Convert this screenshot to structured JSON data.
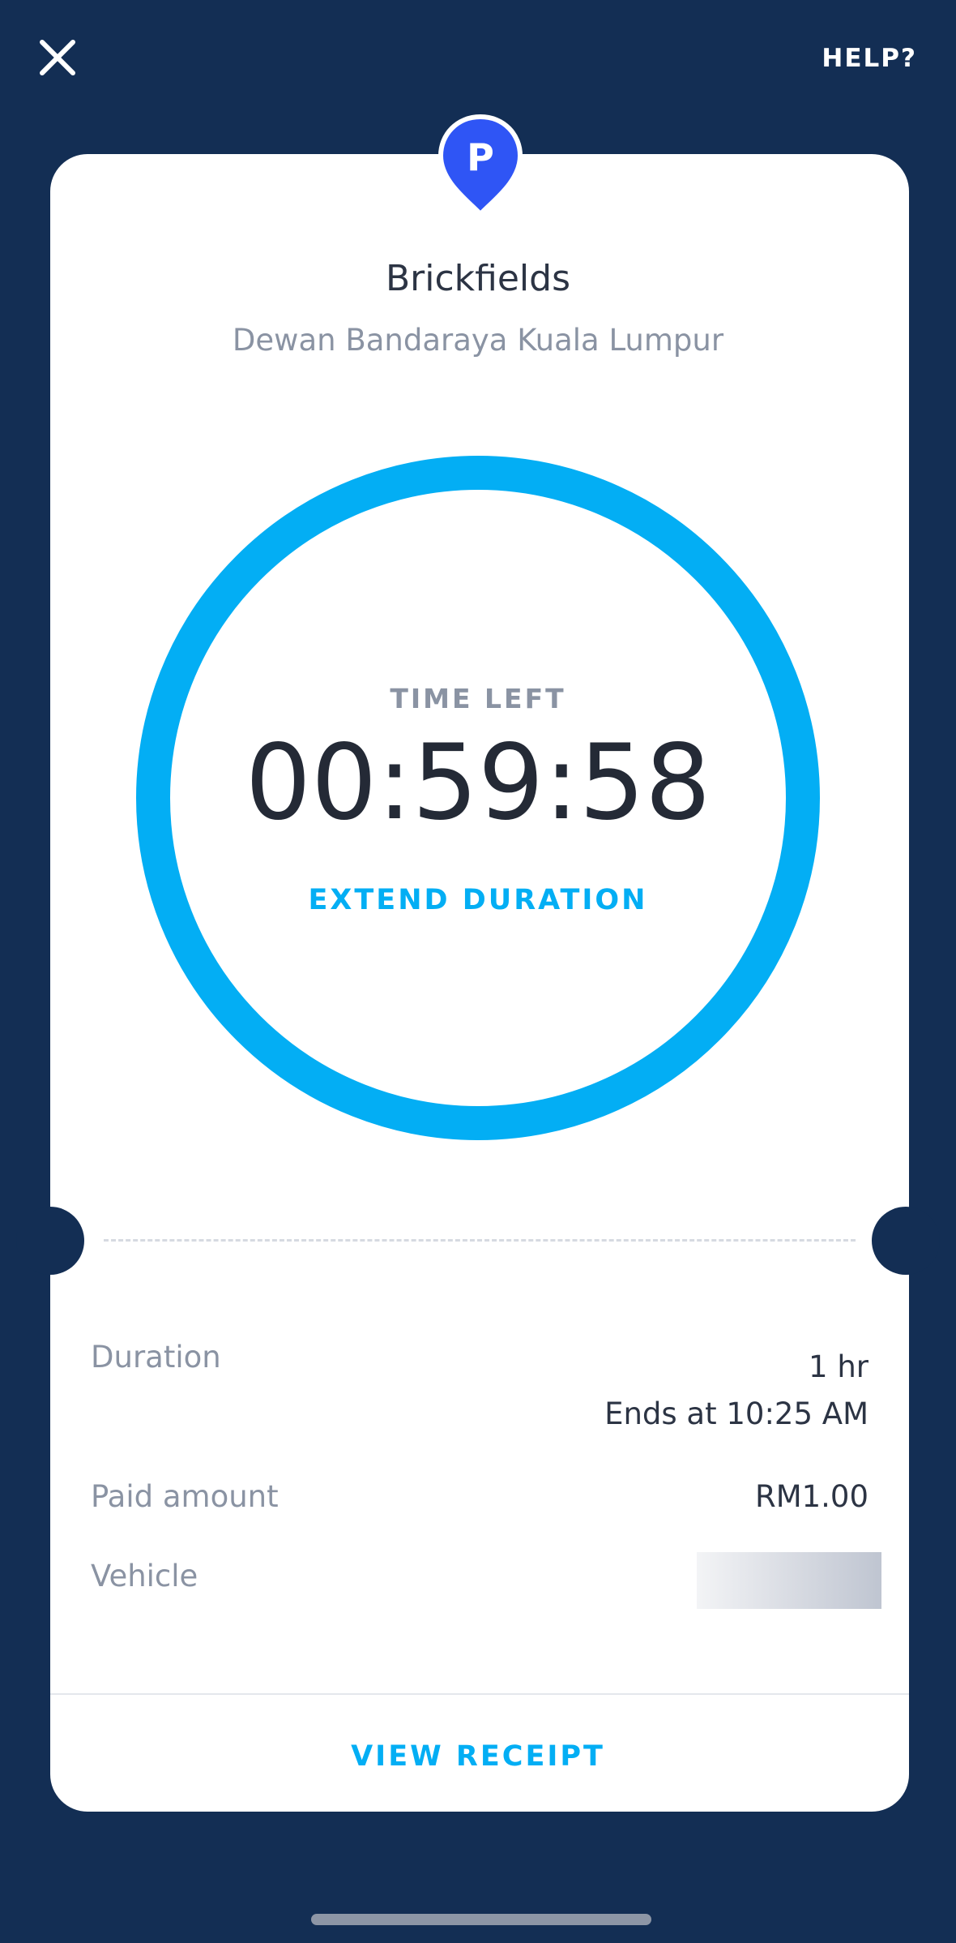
{
  "header": {
    "close_icon": "close-icon",
    "help_label": "HELP?"
  },
  "location": {
    "pin_icon": "parking-pin-icon",
    "pin_letter": "P",
    "name": "Brickfields",
    "authority": "Dewan Bandaraya Kuala Lumpur"
  },
  "timer": {
    "label": "TIME LEFT",
    "value": "00:59:58",
    "extend_label": "EXTEND DURATION",
    "ring_progress": 1.0
  },
  "details": {
    "duration": {
      "label": "Duration",
      "value": "1 hr",
      "ends_at": "Ends at 10:25 AM"
    },
    "paid": {
      "label": "Paid amount",
      "value": "RM1.00"
    },
    "vehicle": {
      "label": "Vehicle"
    }
  },
  "footer": {
    "receipt_label": "VIEW RECEIPT"
  },
  "colors": {
    "background": "#132e54",
    "accent": "#03aef4",
    "pin": "#2f55f5",
    "card": "#ffffff",
    "primary_text": "#2c3444",
    "secondary_text": "#8a93a3"
  }
}
